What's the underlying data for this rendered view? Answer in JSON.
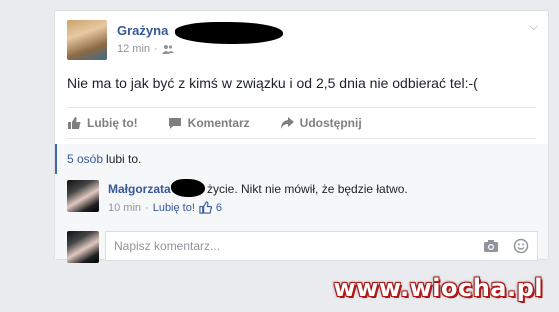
{
  "post": {
    "author": "Grażyna",
    "time": "12 min",
    "separator": "·",
    "privacy_icon": "friends-icon",
    "text": "Nie ma to jak być z kimś w związku i od 2,5 dnia nie odbierać tel:-(",
    "menu_icon": "chevron-down-icon"
  },
  "actions": {
    "like": "Lubię to!",
    "comment": "Komentarz",
    "share": "Udostępnij"
  },
  "likes": {
    "count_link": "5 osób",
    "rest": "lubi to."
  },
  "comment": {
    "author": "Małgorzata",
    "text": "życie. Nikt nie mówił, że będzie łatwo.",
    "time": "10 min",
    "separator": "·",
    "like_link": "Lubię to!",
    "like_count": "6"
  },
  "comment_input": {
    "placeholder": "Napisz komentarz..."
  },
  "watermark": "www.wiocha.pl",
  "colors": {
    "link": "#365899",
    "background": "#e9ebee",
    "watermark_outline": "#b01818"
  }
}
